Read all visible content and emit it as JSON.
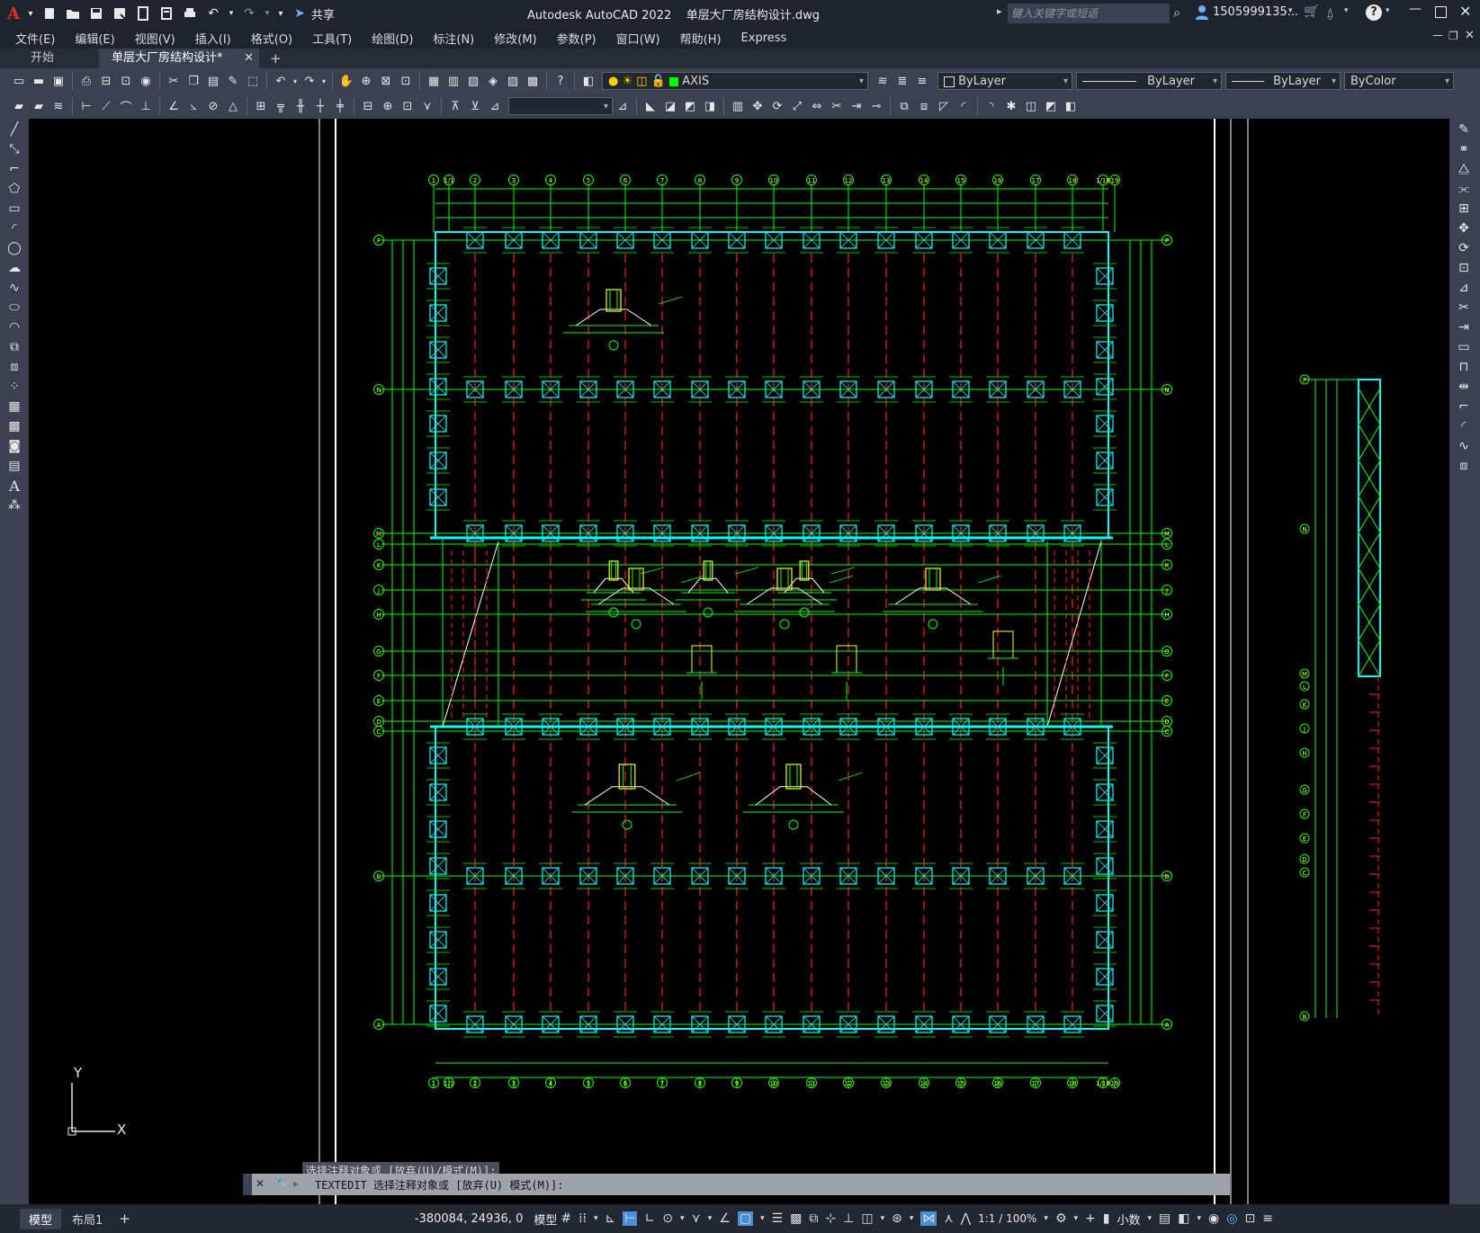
{
  "title_bar": {
    "app_logo": "A",
    "app_logo_menu": "▾",
    "share_label": "共享",
    "title": "Autodesk AutoCAD 2022    单层大厂房结构设计.dwg",
    "search_placeholder": "键入关键字或短语",
    "user": "1505999135...",
    "quick_access_icons": [
      "new-icon",
      "open-icon",
      "save-icon",
      "saveas-icon",
      "publish-icon",
      "web-icon",
      "plot-icon",
      "undo-icon",
      "redo-icon",
      "dropdown-icon"
    ]
  },
  "menu": [
    "文件(E)",
    "编辑(E)",
    "视图(V)",
    "插入(I)",
    "格式(O)",
    "工具(T)",
    "绘图(D)",
    "标注(N)",
    "修改(M)",
    "参数(P)",
    "窗口(W)",
    "帮助(H)",
    "Express"
  ],
  "tabs": [
    {
      "label": "开始",
      "active": false
    },
    {
      "label": "单层大厂房结构设计*",
      "active": true
    }
  ],
  "tab_close": "✕",
  "tab_add": "+",
  "toolbar": {
    "layer": "AXIS",
    "color": "ByLayer",
    "linetype": "ByLayer",
    "lineweight": "ByLayer",
    "plotstyle": "ByColor",
    "layer_color": "#00ff00",
    "text_style": ""
  },
  "drawing": {
    "col_labels": [
      "1",
      "1/1",
      "2",
      "3",
      "4",
      "5",
      "6",
      "7",
      "8",
      "9",
      "10",
      "11",
      "12",
      "13",
      "14",
      "15",
      "16",
      "17",
      "18",
      "1/18",
      "19"
    ],
    "row_labels": [
      "P",
      "N",
      "M",
      "L",
      "K",
      "J",
      "H",
      "G",
      "F",
      "E",
      "D",
      "C",
      "B",
      "A"
    ],
    "ucs_x": "X",
    "ucs_y": "Y"
  },
  "command": {
    "history": "选择注释对象或 [放弃(U)/模式(M)]:",
    "prompt": "TEXTEDIT 选择注释对象或 [放弃(U) 模式(M)]:"
  },
  "status": {
    "model_tab": "模型",
    "layout_tab": "布局1",
    "add_layout": "+",
    "coords": "-380084, 24936, 0",
    "space": "模型",
    "scale": "1:1 / 100%",
    "units": "小数"
  },
  "colors": {
    "canvas_bg": "#000000",
    "line_green": "#00ff00",
    "axis_red": "#ff2020",
    "detail_yellow": "#ffff00",
    "cyan": "#00ffff"
  }
}
